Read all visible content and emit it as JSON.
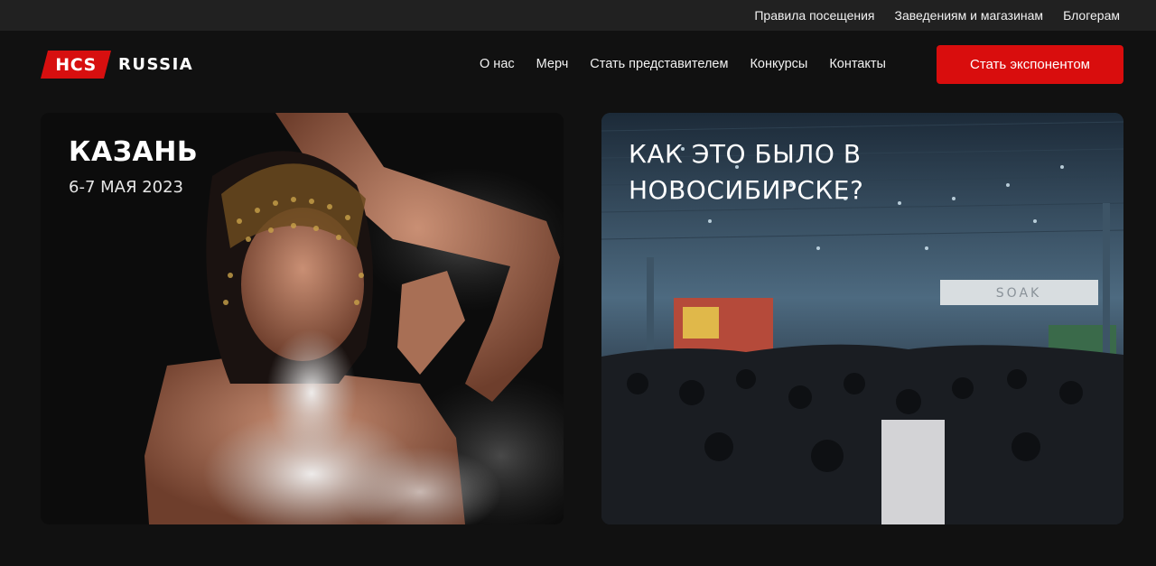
{
  "topbar": {
    "links": [
      "Правила посещения",
      "Заведениям и магазинам",
      "Блогерам"
    ]
  },
  "header": {
    "logo_badge": "HCS",
    "logo_word": "RUSSIA",
    "nav": [
      "О нас",
      "Мерч",
      "Стать представителем",
      "Конкурсы",
      "Контакты"
    ],
    "cta_label": "Стать экспонентом"
  },
  "cards": [
    {
      "title": "КАЗАНЬ",
      "date": "6-7 МАЯ 2023",
      "image": "woman-with-smoke-photo"
    },
    {
      "title": "КАК ЭТО БЫЛО В НОВОСИБИРСКЕ?",
      "image": "expo-hall-crowd-photo",
      "sign_text": "SOAK"
    }
  ],
  "colors": {
    "accent": "#d90d0d",
    "background": "#111111",
    "topbar": "#212121"
  }
}
